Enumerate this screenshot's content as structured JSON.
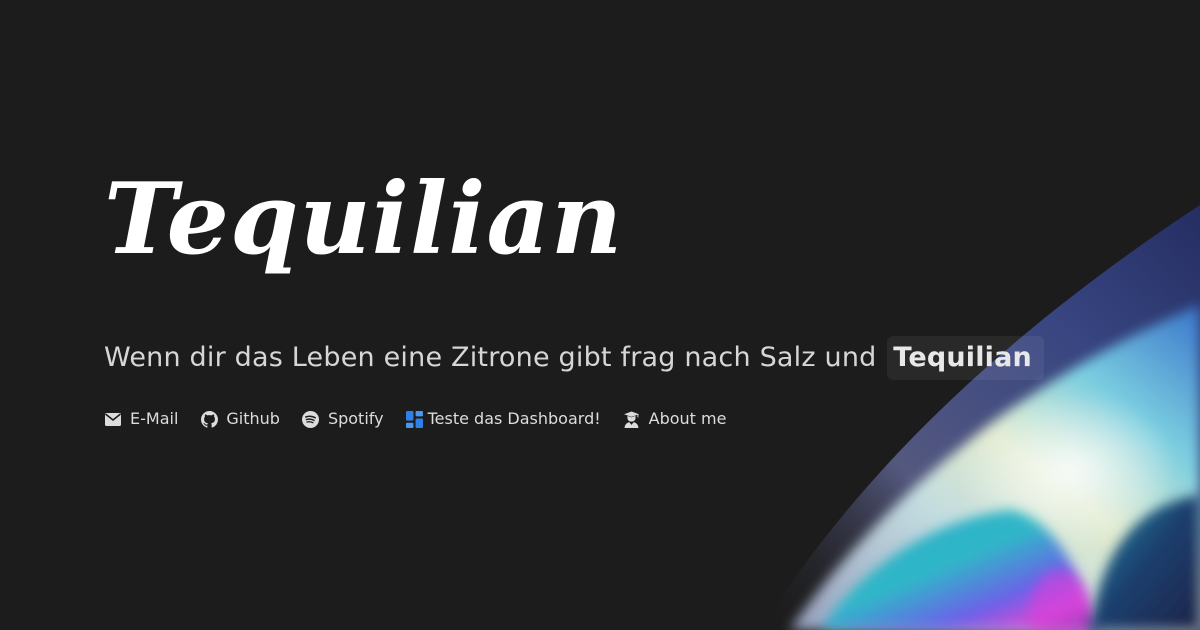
{
  "brand": {
    "title": "Tequilian"
  },
  "tagline": {
    "text": "Wenn dir das Leben eine Zitrone gibt frag nach Salz und",
    "highlight": "Tequilian"
  },
  "links": [
    {
      "label": "E-Mail",
      "icon": "envelope-icon"
    },
    {
      "label": "Github",
      "icon": "github-icon"
    },
    {
      "label": "Spotify",
      "icon": "spotify-icon"
    },
    {
      "label": "Teste das Dashboard!",
      "icon": "dashboard-icon"
    },
    {
      "label": "About me",
      "icon": "user-graduate-icon"
    }
  ],
  "colors": {
    "background": "#1c1c1c",
    "text": "#dcdcdc",
    "dashboard_icon": "#2f7fe6"
  }
}
